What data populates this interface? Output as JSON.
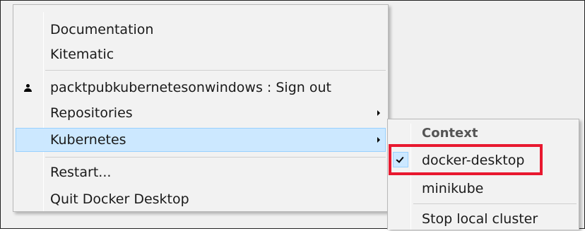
{
  "menu": {
    "items": [
      {
        "label": "Documentation"
      },
      {
        "label": "Kitematic"
      },
      {
        "label": "packtpubkubernetesonwindows : Sign out",
        "icon": "person-icon"
      },
      {
        "label": "Repositories",
        "submenu": true
      },
      {
        "label": "Kubernetes",
        "submenu": true,
        "selected": true
      },
      {
        "label": "Restart..."
      },
      {
        "label": "Quit Docker Desktop"
      }
    ]
  },
  "submenu": {
    "header": "Context",
    "items": [
      {
        "label": "docker-desktop",
        "checked": true
      },
      {
        "label": "minikube"
      },
      {
        "label": "Stop local cluster"
      }
    ]
  },
  "colors": {
    "selection": "#cce8ff",
    "selection_border": "#99d1ff",
    "annotation": "#e8182f",
    "menu_background": "#f2f2f2"
  }
}
